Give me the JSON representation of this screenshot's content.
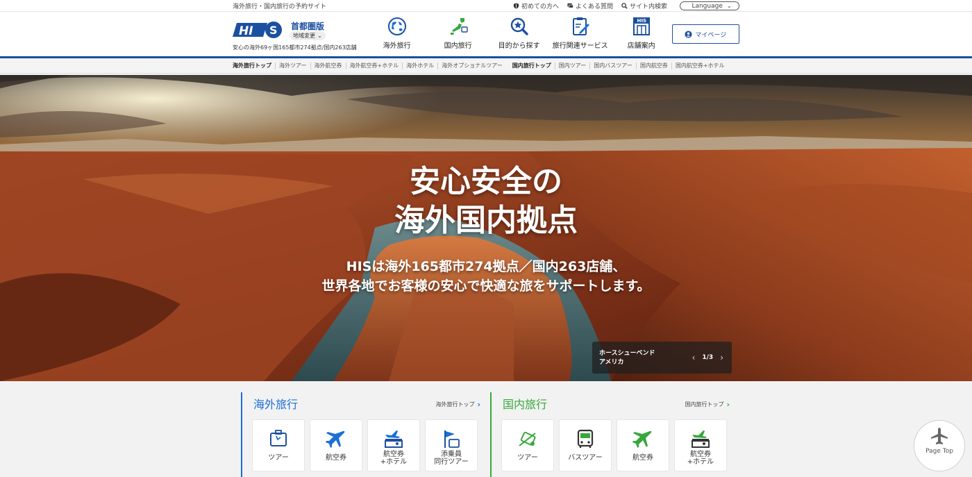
{
  "utility": {
    "site_desc": "海外旅行・国内旅行の予約サイト",
    "links": [
      {
        "label": "初めての方へ",
        "icon": "shield-icon"
      },
      {
        "label": "よくある質問",
        "icon": "chat-icon"
      },
      {
        "label": "サイト内検索",
        "icon": "search-icon"
      }
    ],
    "language_label": "Language"
  },
  "header": {
    "logo_text": "HIS",
    "region": "首都圏版",
    "region_change": "地域変更",
    "tagline": "安心の海外69ヶ国165都市274拠点/国内263店舗",
    "nav": [
      {
        "label": "海外旅行",
        "icon": "globe-icon"
      },
      {
        "label": "国内旅行",
        "icon": "japan-map-icon"
      },
      {
        "label": "目的から探す",
        "icon": "magnifier-star-icon"
      },
      {
        "label": "旅行関連サービス",
        "icon": "clipboard-icon"
      },
      {
        "label": "店舗案内",
        "icon": "store-icon"
      }
    ],
    "store_sign": "HIS",
    "mypage_label": "マイページ"
  },
  "subnav": {
    "abroad": [
      "海外旅行トップ",
      "海外ツアー",
      "海外航空券",
      "海外航空券+ホテル",
      "海外ホテル",
      "海外オプショナルツアー"
    ],
    "domestic": [
      "国内旅行トップ",
      "国内ツアー",
      "国内バスツアー",
      "国内航空券",
      "国内航空券+ホテル"
    ]
  },
  "hero": {
    "title_line1": "安心安全の",
    "title_line2": "海外国内拠点",
    "sub_line1": "HISは海外165都市274拠点／国内263店舗、",
    "sub_line2": "世界各地でお客様の安心で快適な旅をサポートします。",
    "caption_place": "ホースシューベンド",
    "caption_country": "アメリカ",
    "pager": "1/3"
  },
  "abroad_panel": {
    "title": "海外旅行",
    "link": "海外旅行トップ",
    "cards": [
      {
        "label": "ツアー",
        "icon": "suitcase-icon"
      },
      {
        "label": "航空券",
        "icon": "airplane-icon"
      },
      {
        "line1": "航空券",
        "line2": "+ホテル",
        "icon": "plane-hotel-icon"
      },
      {
        "line1": "添乗員",
        "line2": "同行ツアー",
        "icon": "flag-icon"
      }
    ],
    "accent": "#1b6fd6"
  },
  "domestic_panel": {
    "title": "国内旅行",
    "link": "国内旅行トップ",
    "cards": [
      {
        "label": "ツアー",
        "icon": "tour-icon"
      },
      {
        "label": "バスツアー",
        "icon": "bus-icon"
      },
      {
        "label": "航空券",
        "icon": "airplane-icon"
      },
      {
        "line1": "航空券",
        "line2": "+ホテル",
        "icon": "plane-hotel-icon"
      }
    ],
    "accent": "#37a83b"
  },
  "page_top": "Page Top"
}
